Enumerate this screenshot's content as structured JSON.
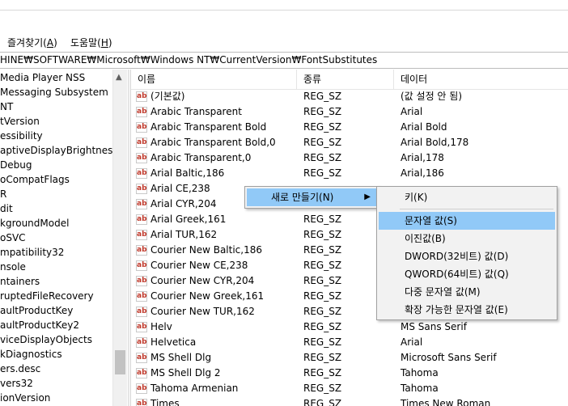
{
  "menu": {
    "favorites": {
      "label": "즐겨찾기(",
      "key": "A",
      "suffix": ")"
    },
    "help": {
      "label": "도움말(",
      "key": "H",
      "suffix": ")"
    }
  },
  "address": "HINE₩SOFTWARE₩Microsoft₩Windows NT₩CurrentVersion₩FontSubstitutes",
  "tree": {
    "items": [
      "Media Player NSS",
      "Messaging Subsystem",
      "NT",
      "tVersion",
      "essibility",
      "aptiveDisplayBrightness",
      "Debug",
      "oCompatFlags",
      "R",
      "dit",
      "kgroundModel",
      "oSVC",
      "mpatibility32",
      "nsole",
      "ntainers",
      "ruptedFileRecovery",
      "aultProductKey",
      "aultProductKey2",
      "viceDisplayObjects",
      "kDiagnostics",
      "ers.desc",
      "vers32",
      "ionVersion"
    ],
    "scroll_up": "▲"
  },
  "list": {
    "headers": {
      "name": "이름",
      "type": "종류",
      "data": "데이터"
    },
    "icon_text": "ab",
    "rows": [
      {
        "name": "(기본값)",
        "type": "REG_SZ",
        "data": "(값 설정 안 됨)"
      },
      {
        "name": "Arabic Transparent",
        "type": "REG_SZ",
        "data": "Arial"
      },
      {
        "name": "Arabic Transparent Bold",
        "type": "REG_SZ",
        "data": "Arial Bold"
      },
      {
        "name": "Arabic Transparent Bold,0",
        "type": "REG_SZ",
        "data": "Arial Bold,178"
      },
      {
        "name": "Arabic Transparent,0",
        "type": "REG_SZ",
        "data": "Arial,178"
      },
      {
        "name": "Arial Baltic,186",
        "type": "REG_SZ",
        "data": "Arial,186"
      },
      {
        "name": "Arial CE,238",
        "type": "",
        "data": ""
      },
      {
        "name": "Arial CYR,204",
        "type": "",
        "data": ""
      },
      {
        "name": "Arial Greek,161",
        "type": "REG_SZ",
        "data": ""
      },
      {
        "name": "Arial TUR,162",
        "type": "REG_SZ",
        "data": ""
      },
      {
        "name": "Courier New Baltic,186",
        "type": "REG_SZ",
        "data": ""
      },
      {
        "name": "Courier New CE,238",
        "type": "REG_SZ",
        "data": ""
      },
      {
        "name": "Courier New CYR,204",
        "type": "REG_SZ",
        "data": ""
      },
      {
        "name": "Courier New Greek,161",
        "type": "REG_SZ",
        "data": ""
      },
      {
        "name": "Courier New TUR,162",
        "type": "REG_SZ",
        "data": ""
      },
      {
        "name": "Helv",
        "type": "REG_SZ",
        "data": "MS Sans Serif"
      },
      {
        "name": "Helvetica",
        "type": "REG_SZ",
        "data": "Arial"
      },
      {
        "name": "MS Shell Dlg",
        "type": "REG_SZ",
        "data": "Microsoft Sans Serif"
      },
      {
        "name": "MS Shell Dlg 2",
        "type": "REG_SZ",
        "data": "Tahoma"
      },
      {
        "name": "Tahoma Armenian",
        "type": "REG_SZ",
        "data": "Tahoma"
      },
      {
        "name": "Times",
        "type": "REG_SZ",
        "data": "Times New Roman"
      }
    ]
  },
  "context_menu": {
    "new_item": "새로 만들기(N)",
    "arrow": "▶"
  },
  "submenu": {
    "items": [
      {
        "label": "키(K)",
        "highlighted": false
      },
      {
        "label": "문자열 값(S)",
        "highlighted": true
      },
      {
        "label": "이진값(B)",
        "highlighted": false
      },
      {
        "label": "DWORD(32비트) 값(D)",
        "highlighted": false
      },
      {
        "label": "QWORD(64비트) 값(Q)",
        "highlighted": false
      },
      {
        "label": "다중 문자열 값(M)",
        "highlighted": false
      },
      {
        "label": "확장 가능한 문자열 값(E)",
        "highlighted": false
      }
    ]
  },
  "colors": {
    "highlight": "#91c9f7",
    "menu_bg": "#f2f2f2",
    "icon_red": "#c0392b"
  }
}
